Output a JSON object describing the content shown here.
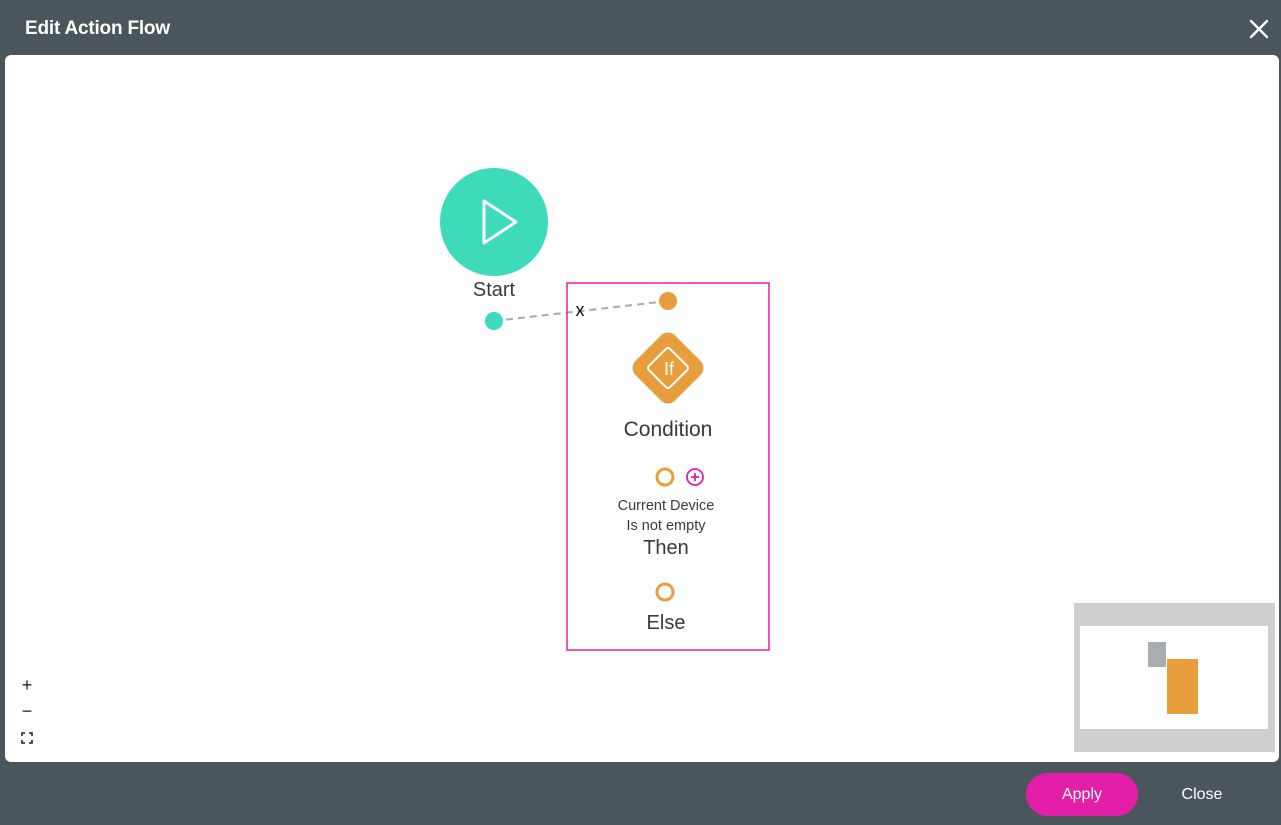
{
  "header": {
    "title": "Edit Action Flow",
    "close_icon": "close-icon"
  },
  "flow": {
    "start": {
      "label": "Start",
      "icon": "play-icon",
      "color": "#3ddbb9"
    },
    "connector": {
      "remove_label": "x"
    },
    "condition": {
      "label": "Condition",
      "icon_text": "If",
      "color": "#e89e3c",
      "selection_color": "#e31fa9",
      "criteria_line1": "Current Device",
      "criteria_line2": "Is not empty",
      "then_label": "Then",
      "else_label": "Else",
      "add_icon": "plus-circle-icon"
    }
  },
  "zoom_controls": {
    "zoom_in": "+",
    "zoom_out": "−",
    "fit_icon": "fit-screen-icon"
  },
  "footer": {
    "apply_label": "Apply",
    "close_label": "Close",
    "apply_color": "#e31fa9"
  }
}
